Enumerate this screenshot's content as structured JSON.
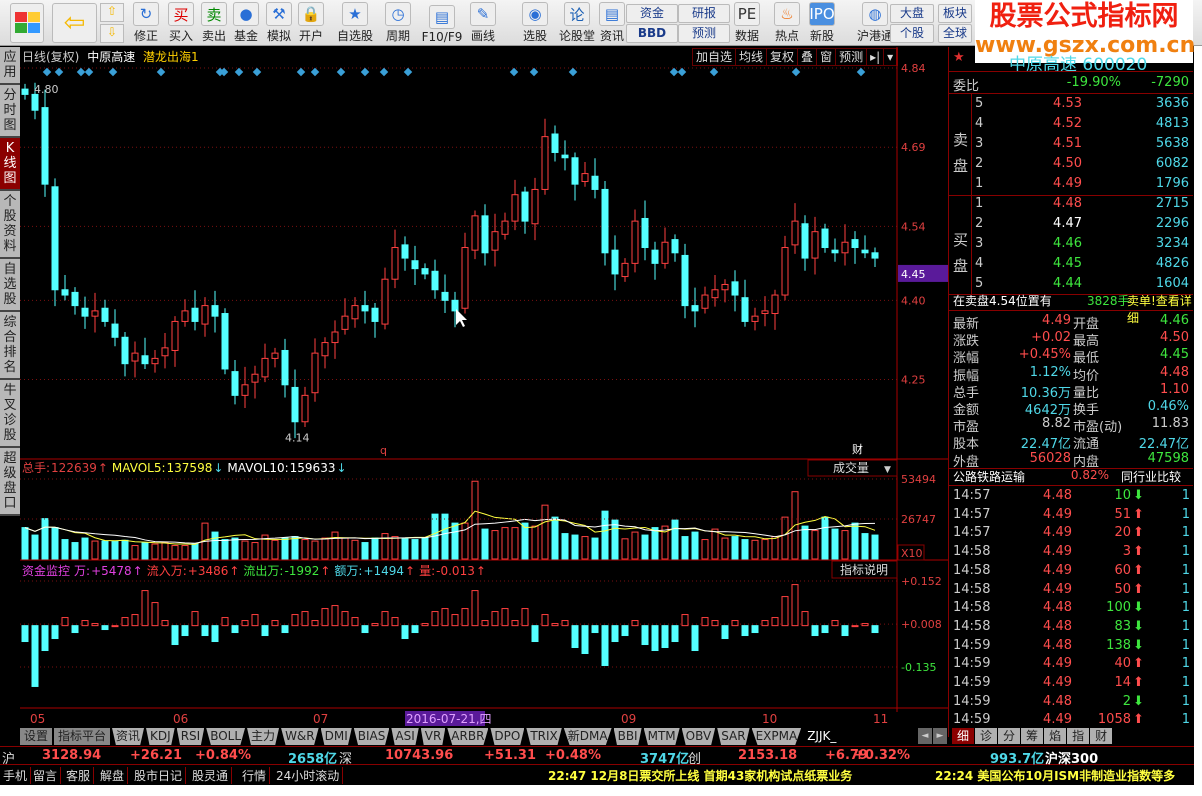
{
  "toolbar": {
    "items": [
      {
        "label": "修正",
        "icon": "refresh-icon"
      },
      {
        "label": "买入",
        "icon": "buy-icon",
        "glyph": "买"
      },
      {
        "label": "卖出",
        "icon": "sell-icon",
        "glyph": "卖"
      },
      {
        "label": "基金",
        "icon": "fund-icon"
      },
      {
        "label": "模拟",
        "icon": "gavel-icon"
      },
      {
        "label": "开户",
        "icon": "lock-icon"
      },
      {
        "label": "自选股",
        "icon": "folder-star-icon"
      },
      {
        "label": "周期",
        "icon": "clock-icon"
      },
      {
        "label": "F10/F9",
        "icon": "document-icon"
      },
      {
        "label": "画线",
        "icon": "pencil-icon"
      },
      {
        "label": "选股",
        "icon": "radar-icon"
      },
      {
        "label": "论股堂",
        "icon": "forum-icon",
        "glyph": "论"
      },
      {
        "label": "资讯",
        "icon": "news-icon"
      },
      {
        "label": "数据",
        "icon": "pe-icon",
        "glyph": "PE"
      },
      {
        "label": "热点",
        "icon": "hot-icon"
      },
      {
        "label": "新股",
        "icon": "ipo-icon",
        "glyph": "IPO"
      },
      {
        "label": "沪港通",
        "icon": "sse-hke-icon"
      }
    ],
    "small": {
      "fund": "资金",
      "bbd": "BBD",
      "research": "研报",
      "forecast": "预测",
      "market": "大盘",
      "stock": "个股",
      "sector": "板块",
      "global": "全球"
    }
  },
  "watermark": {
    "line1": "股票公式指标网",
    "line2": "www.gszx.com.cn"
  },
  "sidebar": [
    "应用",
    "分时图",
    "K线图",
    "个股资料",
    "自选股",
    "综合排名",
    "牛叉诊股",
    "超级盘口"
  ],
  "chart_header": {
    "period": "日线(复权)",
    "stock": "中原高速",
    "indicator": "潜龙出海1"
  },
  "chart_buttons": [
    "加自选",
    "均线",
    "复权",
    "叠",
    "窗",
    "预测"
  ],
  "chart_data": [
    {
      "type": "candlestick",
      "title": "日线(复权) 中原高速",
      "ylim": [
        4.1,
        4.86
      ],
      "yticks": [
        "4.84",
        "4.69",
        "4.54",
        "4.40",
        "4.25"
      ],
      "current_price_label": "4.45",
      "max_label": "4.80",
      "min_label": "4.14",
      "marker_q": "q",
      "marker_cai": "财",
      "close": [
        4.79,
        4.76,
        4.62,
        4.42,
        4.41,
        4.39,
        4.37,
        4.38,
        4.36,
        4.33,
        4.28,
        4.3,
        4.28,
        4.29,
        4.31,
        4.36,
        4.38,
        4.36,
        4.39,
        4.37,
        4.27,
        4.22,
        4.24,
        4.26,
        4.29,
        4.3,
        4.24,
        4.17,
        4.22,
        4.3,
        4.32,
        4.34,
        4.37,
        4.39,
        4.38,
        4.36,
        4.44,
        4.5,
        4.48,
        4.46,
        4.45,
        4.42,
        4.4,
        4.38,
        4.5,
        4.56,
        4.49,
        4.53,
        4.55,
        4.6,
        4.55,
        4.61,
        4.71,
        4.68,
        4.67,
        4.62,
        4.64,
        4.61,
        4.49,
        4.45,
        4.47,
        4.55,
        4.5,
        4.47,
        4.51,
        4.49,
        4.39,
        4.38,
        4.41,
        4.42,
        4.43,
        4.41,
        4.36,
        4.37,
        4.38,
        4.41,
        4.5,
        4.55,
        4.48,
        4.53,
        4.5,
        4.49,
        4.51,
        4.5,
        4.49,
        4.48
      ],
      "x_labels": [
        "05",
        "06",
        "07",
        "2016-07-21,四",
        "09",
        "10",
        "11"
      ]
    },
    {
      "type": "bar",
      "title": "成交量",
      "legend": {
        "total_label": "总手:",
        "total": "122639",
        "ma5_label": "MAVOL5:",
        "ma5": "137598",
        "ma10_label": "MAVOL10:",
        "ma10": "159633"
      },
      "yticks": [
        "53494",
        "26747"
      ],
      "unit": "X10",
      "ylim": [
        0,
        53494
      ],
      "values": [
        21000,
        16000,
        27000,
        21000,
        13000,
        11000,
        14000,
        12000,
        12000,
        12000,
        12500,
        9000,
        11000,
        10000,
        11000,
        9000,
        9000,
        10000,
        24000,
        18000,
        13000,
        14000,
        12000,
        11000,
        16000,
        12500,
        14000,
        15000,
        13000,
        12000,
        14000,
        18000,
        14000,
        12500,
        11000,
        14000,
        17000,
        15000,
        13500,
        13000,
        14000,
        30000,
        30000,
        24000,
        24000,
        52000,
        20000,
        19000,
        21000,
        21000,
        24000,
        22000,
        36000,
        28000,
        17000,
        16000,
        15000,
        14000,
        32000,
        26000,
        13500,
        18000,
        16000,
        21000,
        22000,
        26000,
        15000,
        18000,
        13000,
        20000,
        14000,
        15000,
        13000,
        12500,
        13000,
        15000,
        28000,
        45000,
        22000,
        19000,
        28000,
        20000,
        19000,
        24000,
        17000,
        16000
      ],
      "select_label": "成交量"
    },
    {
      "type": "bar",
      "title": "资金监控",
      "legend": {
        "name": "资金监控",
        "wan_label": "万:",
        "wan": "+5478",
        "in_label": "流入万:",
        "in": "+3486",
        "out_label": "流出万:",
        "out": "-1992",
        "amt_label": "额万:",
        "amt": "+1494",
        "liang_label": "量:",
        "liang": "-0.013"
      },
      "yticks": [
        "+0.152",
        "+0.008",
        "-0.135"
      ],
      "ylim": [
        -0.2,
        0.16
      ],
      "button": "指标说明",
      "values": [
        -0.05,
        -0.2,
        -0.08,
        -0.04,
        0.03,
        -0.02,
        0.02,
        0.01,
        -0.01,
        0.0,
        0.03,
        0.04,
        0.12,
        0.08,
        0.02,
        -0.06,
        -0.03,
        0.05,
        -0.03,
        -0.05,
        0.03,
        -0.02,
        0.02,
        0.04,
        -0.03,
        0.02,
        -0.02,
        0.04,
        0.05,
        0.02,
        0.06,
        0.07,
        0.05,
        0.03,
        -0.02,
        0.01,
        0.05,
        0.03,
        -0.04,
        -0.02,
        0.01,
        0.05,
        0.06,
        0.04,
        0.06,
        0.12,
        0.02,
        0.05,
        0.06,
        0.02,
        0.06,
        -0.05,
        0.04,
        0.01,
        0.02,
        -0.07,
        -0.09,
        -0.02,
        -0.13,
        -0.05,
        -0.03,
        0.02,
        -0.06,
        -0.08,
        -0.07,
        -0.05,
        0.04,
        -0.08,
        0.03,
        0.02,
        -0.04,
        0.02,
        -0.03,
        -0.02,
        0.02,
        0.03,
        0.1,
        0.14,
        0.05,
        -0.03,
        -0.02,
        0.02,
        -0.03,
        0.0,
        0.01,
        -0.02
      ]
    }
  ],
  "quote": {
    "title": "中原高速 600020",
    "weibi_label": "委比",
    "weibi_pct": "-19.90%",
    "weibi_val": "-7290",
    "sell_label": "卖盘",
    "buy_label": "买盘",
    "sell": [
      {
        "n": "5",
        "p": "4.53",
        "v": "3636"
      },
      {
        "n": "4",
        "p": "4.52",
        "v": "4813"
      },
      {
        "n": "3",
        "p": "4.51",
        "v": "5638"
      },
      {
        "n": "2",
        "p": "4.50",
        "v": "6082"
      },
      {
        "n": "1",
        "p": "4.49",
        "v": "1796"
      }
    ],
    "buy": [
      {
        "n": "1",
        "p": "4.48",
        "v": "2715",
        "c": "red"
      },
      {
        "n": "2",
        "p": "4.47",
        "v": "2296",
        "c": "wht"
      },
      {
        "n": "3",
        "p": "4.46",
        "v": "3234",
        "c": "grn"
      },
      {
        "n": "4",
        "p": "4.45",
        "v": "4826",
        "c": "grn"
      },
      {
        "n": "5",
        "p": "4.44",
        "v": "1604",
        "c": "grn"
      }
    ],
    "notice": {
      "text": "在卖盘4.54位置有",
      "qty": "3828手",
      "link": "卖单!查看详细"
    },
    "stats": [
      [
        "最新",
        "4.49",
        "red",
        "开盘",
        "4.46",
        "grn"
      ],
      [
        "涨跌",
        "+0.02",
        "red",
        "最高",
        "4.50",
        "red"
      ],
      [
        "涨幅",
        "+0.45%",
        "red",
        "最低",
        "4.45",
        "grn"
      ],
      [
        "振幅",
        "1.12%",
        "cyn",
        "均价",
        "4.48",
        "red"
      ],
      [
        "总手",
        "10.36万",
        "cyn",
        "量比",
        "1.10",
        "red"
      ],
      [
        "金额",
        "4642万",
        "cyn",
        "换手",
        "0.46%",
        "cyn"
      ],
      [
        "市盈",
        "8.82",
        "gry",
        "市盈(动)",
        "11.83",
        "gry"
      ],
      [
        "股本",
        "22.47亿",
        "cyn",
        "流通",
        "22.47亿",
        "cyn"
      ],
      [
        "外盘",
        "56028",
        "red",
        "内盘",
        "47598",
        "grn"
      ]
    ],
    "industry": {
      "name": "公路铁路运输",
      "pct": "0.82%",
      "compare": "同行业比较"
    },
    "ticks": [
      [
        "14:57",
        "4.48",
        "10",
        "down"
      ],
      [
        "14:57",
        "4.49",
        "51",
        "up"
      ],
      [
        "14:57",
        "4.49",
        "20",
        "up"
      ],
      [
        "14:58",
        "4.49",
        "3",
        "up"
      ],
      [
        "14:58",
        "4.49",
        "60",
        "up"
      ],
      [
        "14:58",
        "4.49",
        "50",
        "up"
      ],
      [
        "14:58",
        "4.48",
        "100",
        "down"
      ],
      [
        "14:58",
        "4.48",
        "83",
        "down"
      ],
      [
        "14:59",
        "4.48",
        "138",
        "down"
      ],
      [
        "14:59",
        "4.49",
        "40",
        "up"
      ],
      [
        "14:59",
        "4.49",
        "14",
        "up"
      ],
      [
        "14:59",
        "4.48",
        "2",
        "down"
      ],
      [
        "14:59",
        "4.49",
        "1058",
        "up"
      ]
    ],
    "tick_count": "1"
  },
  "bottom_tabs": [
    "设置",
    "指标平台",
    "资讯",
    "KDJ",
    "RSI",
    "BOLL",
    "主力",
    "W&R",
    "DMI",
    "BIAS",
    "ASI",
    "VR",
    "ARBR",
    "DPO",
    "TRIX",
    "新DMA",
    "BBI",
    "MTM",
    "OBV",
    "SAR",
    "EXPMA",
    "ZJJK_"
  ],
  "right_tabs": [
    "细",
    "诊",
    "分",
    "筹",
    "焰",
    "指",
    "财"
  ],
  "index_bar": {
    "sh": "沪",
    "sh_val": "3128.94",
    "sh_chg": "+26.21",
    "sh_pct": "+0.84%",
    "sh_amt": "2658亿",
    "sz": "深",
    "sz_val": "10743.96",
    "sz_chg": "+51.31",
    "sz_pct": "+0.48%",
    "sz_amt": "3747亿",
    "cy": "创",
    "cy_val": "2153.18",
    "cy_chg": "+6.79",
    "cy_pct": "+0.32%",
    "cy_amt": "993.7亿",
    "hs": "沪深300"
  },
  "links": [
    "手机",
    "留言",
    "客服",
    "解盘",
    "股市日记",
    "股灵通",
    "行情",
    "24小时滚动"
  ],
  "news": [
    "22:47 12月8日票交所上线 首期43家机构试点纸票业务",
    "22:24 美国公布10月ISM非制造业指数等多"
  ]
}
